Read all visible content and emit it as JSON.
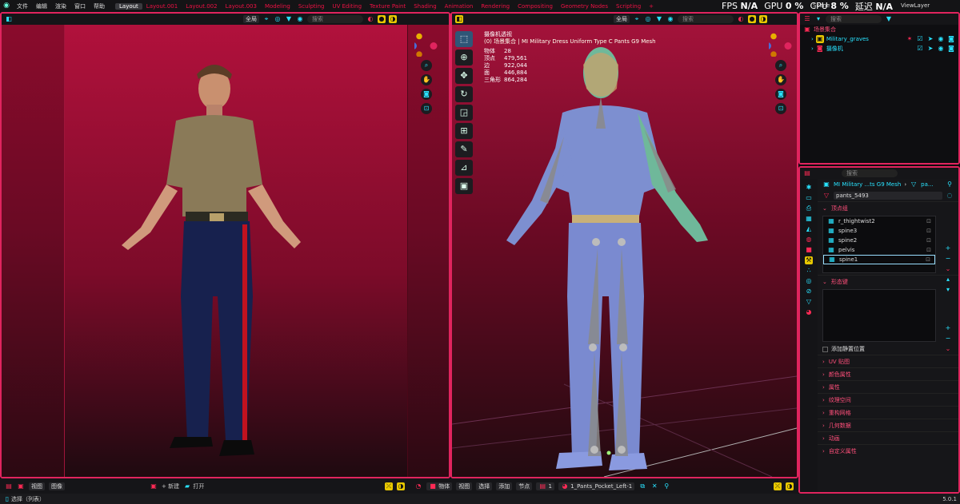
{
  "topbar": {
    "menus": [
      "文件",
      "编辑",
      "渲染",
      "窗口",
      "帮助"
    ],
    "workspaces": [
      "Layout",
      "Layout.001",
      "Layout.002",
      "Layout.003",
      "Modeling",
      "Sculpting",
      "UV Editing",
      "Texture Paint",
      "Shading",
      "Animation",
      "Rendering",
      "Compositing",
      "Geometry Nodes",
      "Scripting"
    ],
    "active_workspace": "Layout",
    "add": "+",
    "fps_label": "FPS",
    "fps_value": "N/A",
    "gpu_label": "GPU",
    "gpu_value": "0 %",
    "cpu_label": "CPU",
    "cpu_value": "8 %",
    "delay_label": "延迟",
    "delay_value": "N/A",
    "scene": "Scene",
    "viewlayer": "ViewLayer"
  },
  "viewport_left": {
    "view_mode": "全局",
    "search": "搜索"
  },
  "viewport_right": {
    "view_mode": "全局",
    "search": "搜索",
    "camera_label": "摄像机透视",
    "collection_path": "(0) 场景集合 | MI Military Dress Uniform Type C Pants G9 Mesh",
    "stats": [
      {
        "label": "物体",
        "value": "28"
      },
      {
        "label": "顶点",
        "value": "479,561"
      },
      {
        "label": "边",
        "value": "922,044"
      },
      {
        "label": "面",
        "value": "446,884"
      },
      {
        "label": "三角形",
        "value": "864,284"
      }
    ]
  },
  "outliner": {
    "search": "搜索",
    "root": "场景集合",
    "items": [
      {
        "label": "Military_graves"
      },
      {
        "label": "摄像机"
      }
    ]
  },
  "properties": {
    "search": "搜索",
    "breadcrumb_object": "MI Military ...ts G9 Mesh",
    "breadcrumb_data": "pa...",
    "mesh_name": "pants_5493",
    "vertex_groups_title": "顶点组",
    "vertex_groups": [
      "r_thightwist2",
      "spine3",
      "spine2",
      "pelvis",
      "spine1"
    ],
    "selected_group": "spine1",
    "shape_keys_title": "形态键",
    "add_rest_position": "添加静置位置",
    "panels": [
      "UV 贴图",
      "颜色属性",
      "属性",
      "纹理空间",
      "重构网格",
      "几何数据",
      "动画",
      "自定义属性"
    ]
  },
  "bottom_left": {
    "view": "视图",
    "image": "图像",
    "new": "新建",
    "open": "打开"
  },
  "bottom_right": {
    "mode": "物体",
    "view": "视图",
    "select": "选择",
    "add": "添加",
    "node": "节点",
    "slot": "1",
    "material": "1_Pants_Pocket_Left-1"
  },
  "status": {
    "select": "选择（列表）",
    "version": "5.0.1"
  },
  "colors": {
    "accent": "#e0245e",
    "cyan": "#29e3ff",
    "yellow": "#e8c800"
  }
}
